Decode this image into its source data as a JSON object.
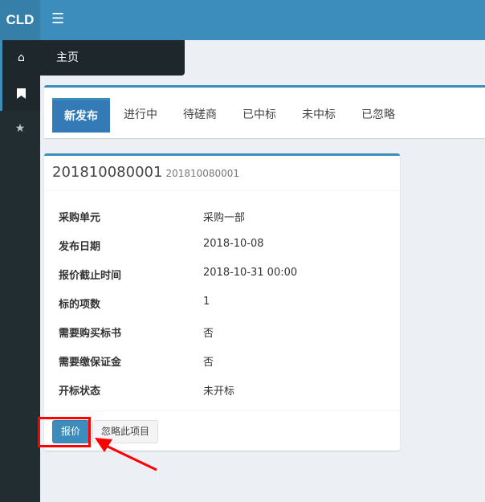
{
  "app": {
    "logo": "CLD"
  },
  "sidebar": {
    "items": [
      {
        "icon": "home-icon",
        "label": "主页"
      },
      {
        "icon": "bookmark-icon"
      },
      {
        "icon": "star-icon"
      }
    ]
  },
  "tabs": [
    {
      "label": "新发布",
      "active": true
    },
    {
      "label": "进行中"
    },
    {
      "label": "待磋商"
    },
    {
      "label": "已中标"
    },
    {
      "label": "未中标"
    },
    {
      "label": "已忽略"
    }
  ],
  "card": {
    "title": "201810080001",
    "subtitle": "201810080001",
    "fields": [
      {
        "k": "采购单元",
        "v": "采购一部"
      },
      {
        "k": "发布日期",
        "v": "2018-10-08"
      },
      {
        "k": "报价截止时间",
        "v": "2018-10-31 00:00"
      },
      {
        "k": "标的项数",
        "v": "1"
      },
      {
        "k": "需要购买标书",
        "v": "否"
      },
      {
        "k": "需要缴保证金",
        "v": "否"
      },
      {
        "k": "开标状态",
        "v": "未开标"
      }
    ],
    "quote_label": "报价",
    "ignore_label": "忽略此项目"
  },
  "colors": {
    "primary": "#3c8dbc",
    "annotation": "#ff0000"
  }
}
